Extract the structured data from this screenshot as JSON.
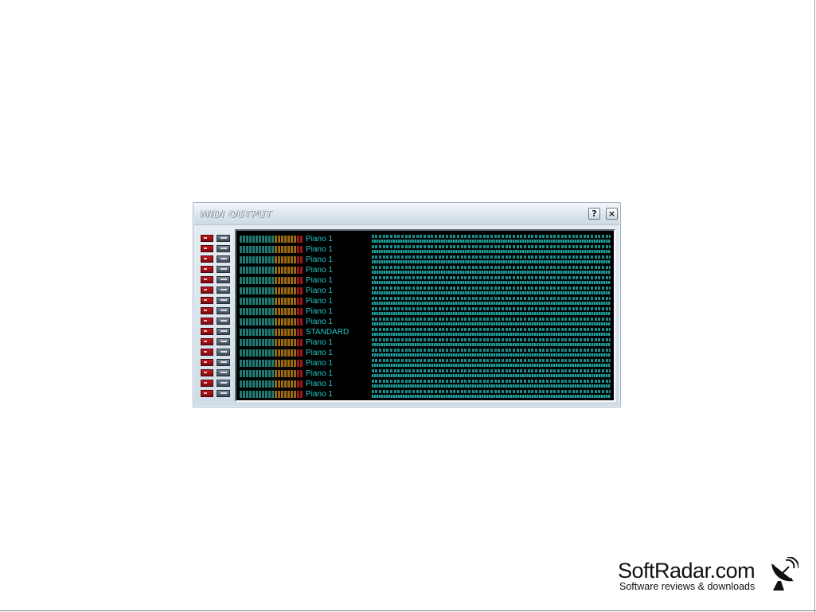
{
  "window": {
    "title": "MIDI OUTPUT",
    "help_label": "?",
    "close_label": "×"
  },
  "channels": [
    {
      "name": "Piano 1"
    },
    {
      "name": "Piano 1"
    },
    {
      "name": "Piano 1"
    },
    {
      "name": "Piano 1"
    },
    {
      "name": "Piano 1"
    },
    {
      "name": "Piano 1"
    },
    {
      "name": "Piano 1"
    },
    {
      "name": "Piano 1"
    },
    {
      "name": "Piano 1"
    },
    {
      "name": "STANDARD"
    },
    {
      "name": "Piano 1"
    },
    {
      "name": "Piano 1"
    },
    {
      "name": "Piano 1"
    },
    {
      "name": "Piano 1"
    },
    {
      "name": "Piano 1"
    },
    {
      "name": "Piano 1"
    }
  ],
  "colors": {
    "channel_text": "#23c4c4",
    "meter_green": "#1e7a73",
    "meter_amber": "#9a6a12",
    "meter_red": "#a0161a",
    "mute_button": "#b3151b",
    "panel_bg": "#000000"
  },
  "icons": {
    "mute": "mute-button-icon",
    "solo": "solo-button-icon",
    "watermark": "satellite-dish-icon"
  },
  "watermark": {
    "name": "SoftRadar.com",
    "tagline": "Software reviews & downloads"
  }
}
